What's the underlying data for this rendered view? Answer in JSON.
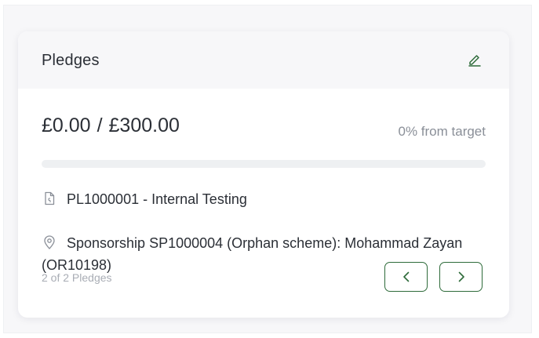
{
  "card": {
    "title": "Pledges",
    "edit_icon": "pencil-icon"
  },
  "amounts": {
    "raised": "£0.00",
    "separator": "/",
    "target": "£300.00",
    "progress_text": "0% from target",
    "progress_fraction": 0
  },
  "details": {
    "reference_icon": "document-icon",
    "reference": "PL1000001 - Internal Testing",
    "sponsorship_icon": "location-pin-icon",
    "sponsorship": "Sponsorship SP1000004 (Orphan scheme): Mohammad Zayan (OR10198)"
  },
  "pager": {
    "status": "2 of 2 Pledges",
    "prev_icon": "chevron-left-icon",
    "next_icon": "chevron-right-icon"
  },
  "colors": {
    "accent": "#2e6b3a",
    "text": "#2b2f36",
    "muted": "#8a8f98",
    "header_bg": "#f7f7f9"
  }
}
